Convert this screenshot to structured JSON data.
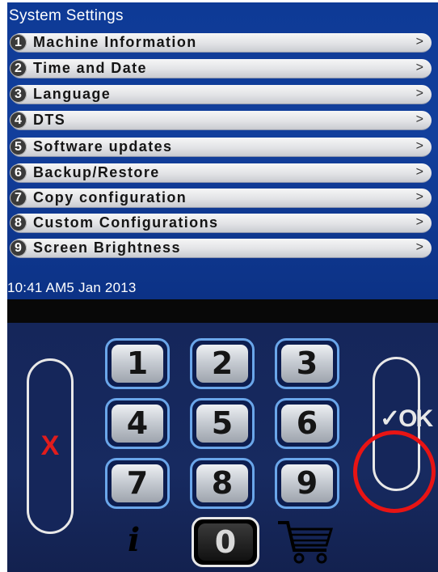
{
  "screen": {
    "title": "System Settings",
    "items": [
      {
        "number": "1",
        "label": "Machine Information",
        "arrow": ">"
      },
      {
        "number": "2",
        "label": "Time and Date",
        "arrow": ">"
      },
      {
        "number": "3",
        "label": "Language",
        "arrow": ">"
      },
      {
        "number": "4",
        "label": "DTS",
        "arrow": ">"
      },
      {
        "number": "5",
        "label": "Software updates",
        "arrow": ">"
      },
      {
        "number": "6",
        "label": "Backup/Restore",
        "arrow": ">"
      },
      {
        "number": "7",
        "label": "Copy configuration",
        "arrow": ">"
      },
      {
        "number": "8",
        "label": "Custom Configurations",
        "arrow": ">"
      },
      {
        "number": "9",
        "label": "Screen Brightness",
        "arrow": ">"
      }
    ],
    "datetime": "10:41 AM5 Jan 2013"
  },
  "keypad": {
    "keys": [
      "1",
      "2",
      "3",
      "4",
      "5",
      "6",
      "7",
      "8",
      "9"
    ],
    "zero": "0",
    "cancel_label": "X",
    "ok_label": "✓OK",
    "info_icon": "info-icon",
    "cart_icon": "cart-icon"
  },
  "colors": {
    "screen_blue": "#123f9c",
    "keypad_navy": "#172a60",
    "key_border": "#6aa6ea",
    "cancel_red": "#e01c1c",
    "highlight_red": "#e81414"
  }
}
